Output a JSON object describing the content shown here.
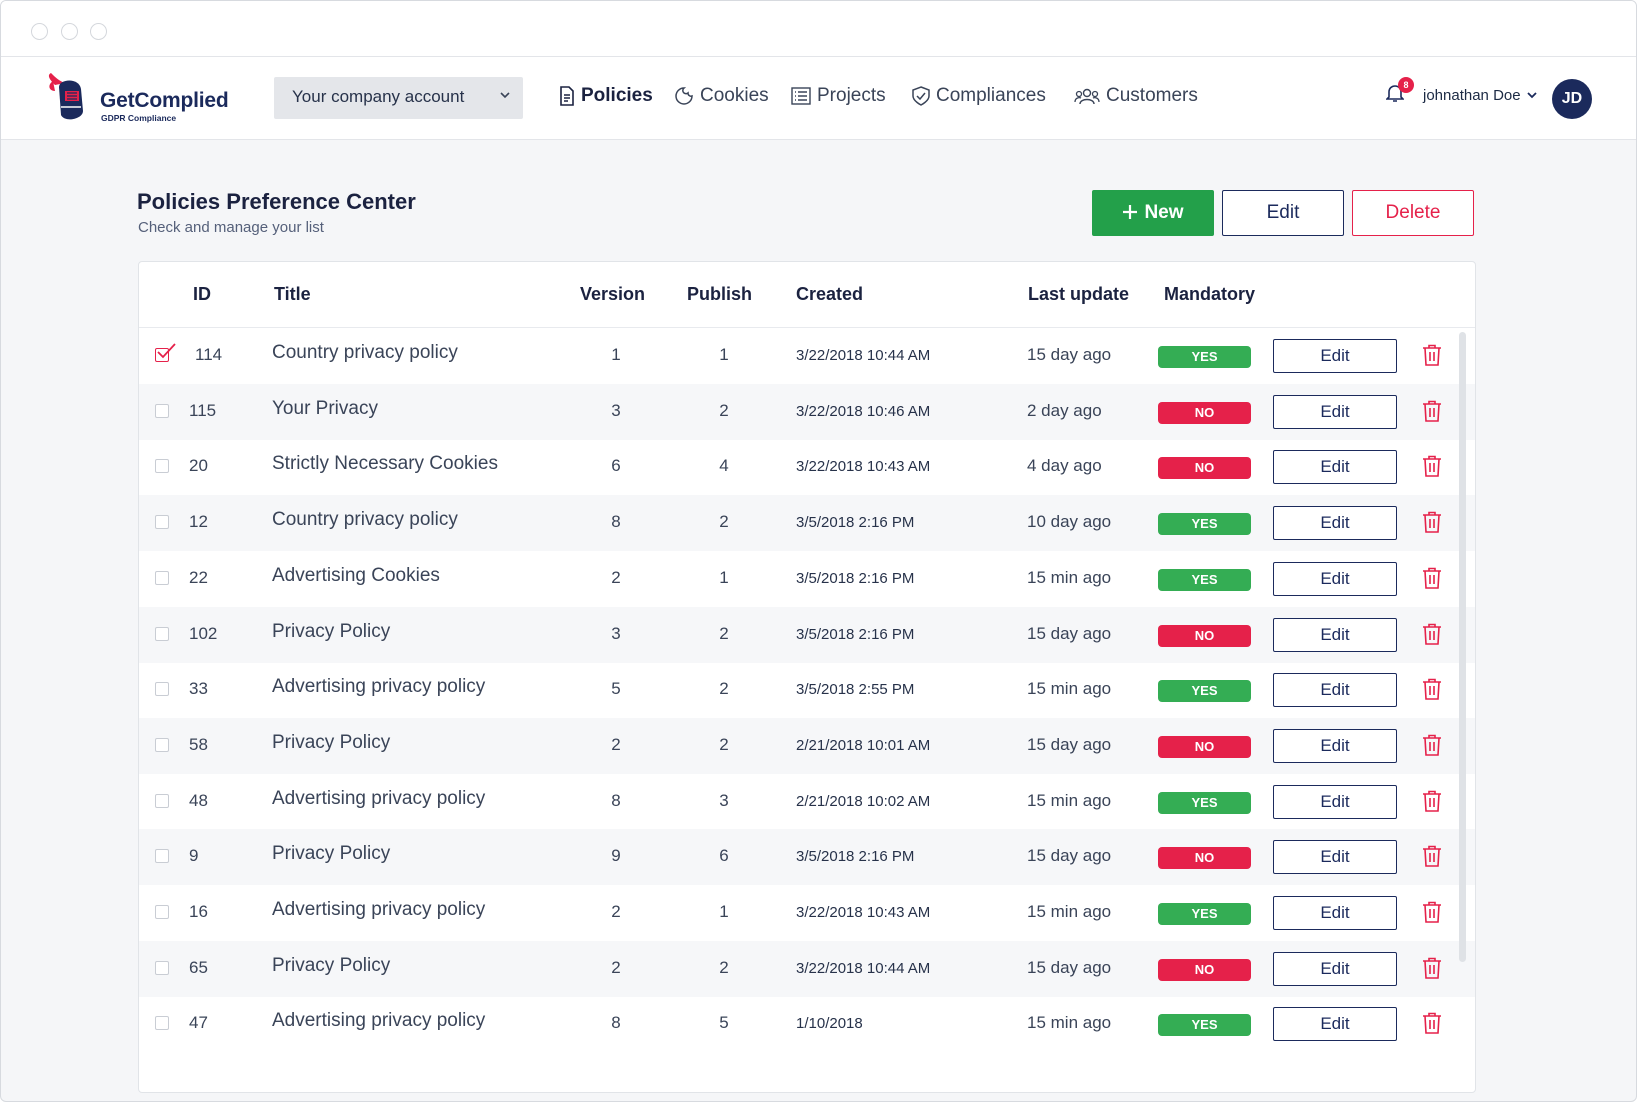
{
  "brand": {
    "name": "GetComplied",
    "tagline": "GDPR Compliance"
  },
  "account_selector": {
    "value": "Your company account"
  },
  "nav": [
    {
      "label": "Policies",
      "icon": "document-icon",
      "active": true
    },
    {
      "label": "Cookies",
      "icon": "cookie-icon",
      "active": false
    },
    {
      "label": "Projects",
      "icon": "list-icon",
      "active": false
    },
    {
      "label": "Compliances",
      "icon": "shield-check-icon",
      "active": false
    },
    {
      "label": "Customers",
      "icon": "users-icon",
      "active": false
    }
  ],
  "user": {
    "notifications": "8",
    "name": "johnathan Doe",
    "initials": "JD"
  },
  "page": {
    "title": "Policies Preference Center",
    "subtitle": "Check and manage your list"
  },
  "toolbar": {
    "new_label": "New",
    "edit_label": "Edit",
    "delete_label": "Delete"
  },
  "table": {
    "headers": {
      "id": "ID",
      "title": "Title",
      "version": "Version",
      "publish": "Publish",
      "created": "Created",
      "last_update": "Last update",
      "mandatory": "Mandatory"
    },
    "row_edit_label": "Edit",
    "rows": [
      {
        "checked": true,
        "id": "114",
        "title": "Country privacy policy",
        "version": "1",
        "publish": "1",
        "created": "3/22/2018 10:44 AM",
        "last_update": "15 day ago",
        "mandatory": "YES"
      },
      {
        "checked": false,
        "id": "115",
        "title": "Your Privacy",
        "version": "3",
        "publish": "2",
        "created": "3/22/2018 10:46 AM",
        "last_update": "2 day ago",
        "mandatory": "NO"
      },
      {
        "checked": false,
        "id": "20",
        "title": "Strictly Necessary Cookies",
        "version": "6",
        "publish": "4",
        "created": "3/22/2018 10:43 AM",
        "last_update": "4 day ago",
        "mandatory": "NO"
      },
      {
        "checked": false,
        "id": "12",
        "title": "Country privacy policy",
        "version": "8",
        "publish": "2",
        "created": "3/5/2018 2:16 PM",
        "last_update": "10 day ago",
        "mandatory": "YES"
      },
      {
        "checked": false,
        "id": "22",
        "title": "Advertising Cookies",
        "version": "2",
        "publish": "1",
        "created": "3/5/2018 2:16 PM",
        "last_update": "15 min ago",
        "mandatory": "YES"
      },
      {
        "checked": false,
        "id": "102",
        "title": "Privacy Policy",
        "version": "3",
        "publish": "2",
        "created": "3/5/2018 2:16 PM",
        "last_update": "15 day ago",
        "mandatory": "NO"
      },
      {
        "checked": false,
        "id": "33",
        "title": "Advertising privacy policy",
        "version": "5",
        "publish": "2",
        "created": "3/5/2018 2:55 PM",
        "last_update": "15 min ago",
        "mandatory": "YES"
      },
      {
        "checked": false,
        "id": "58",
        "title": "Privacy Policy",
        "version": "2",
        "publish": "2",
        "created": "2/21/2018 10:01 AM",
        "last_update": "15 day ago",
        "mandatory": "NO"
      },
      {
        "checked": false,
        "id": "48",
        "title": "Advertising privacy policy",
        "version": "8",
        "publish": "3",
        "created": "2/21/2018 10:02 AM",
        "last_update": "15 min ago",
        "mandatory": "YES"
      },
      {
        "checked": false,
        "id": "9",
        "title": "Privacy Policy",
        "version": "9",
        "publish": "6",
        "created": "3/5/2018 2:16 PM",
        "last_update": "15 day ago",
        "mandatory": "NO"
      },
      {
        "checked": false,
        "id": "16",
        "title": "Advertising privacy policy",
        "version": "2",
        "publish": "1",
        "created": "3/22/2018 10:43 AM",
        "last_update": "15 min ago",
        "mandatory": "YES"
      },
      {
        "checked": false,
        "id": "65",
        "title": "Privacy Policy",
        "version": "2",
        "publish": "2",
        "created": "3/22/2018 10:44 AM",
        "last_update": "15 day ago",
        "mandatory": "NO"
      },
      {
        "checked": false,
        "id": "47",
        "title": "Advertising privacy policy",
        "version": "8",
        "publish": "5",
        "created": "1/10/2018",
        "last_update": "15 min ago",
        "mandatory": "YES"
      }
    ]
  },
  "colors": {
    "brand_navy": "#1b2a5c",
    "success": "#23a04a",
    "danger": "#e5214a"
  }
}
